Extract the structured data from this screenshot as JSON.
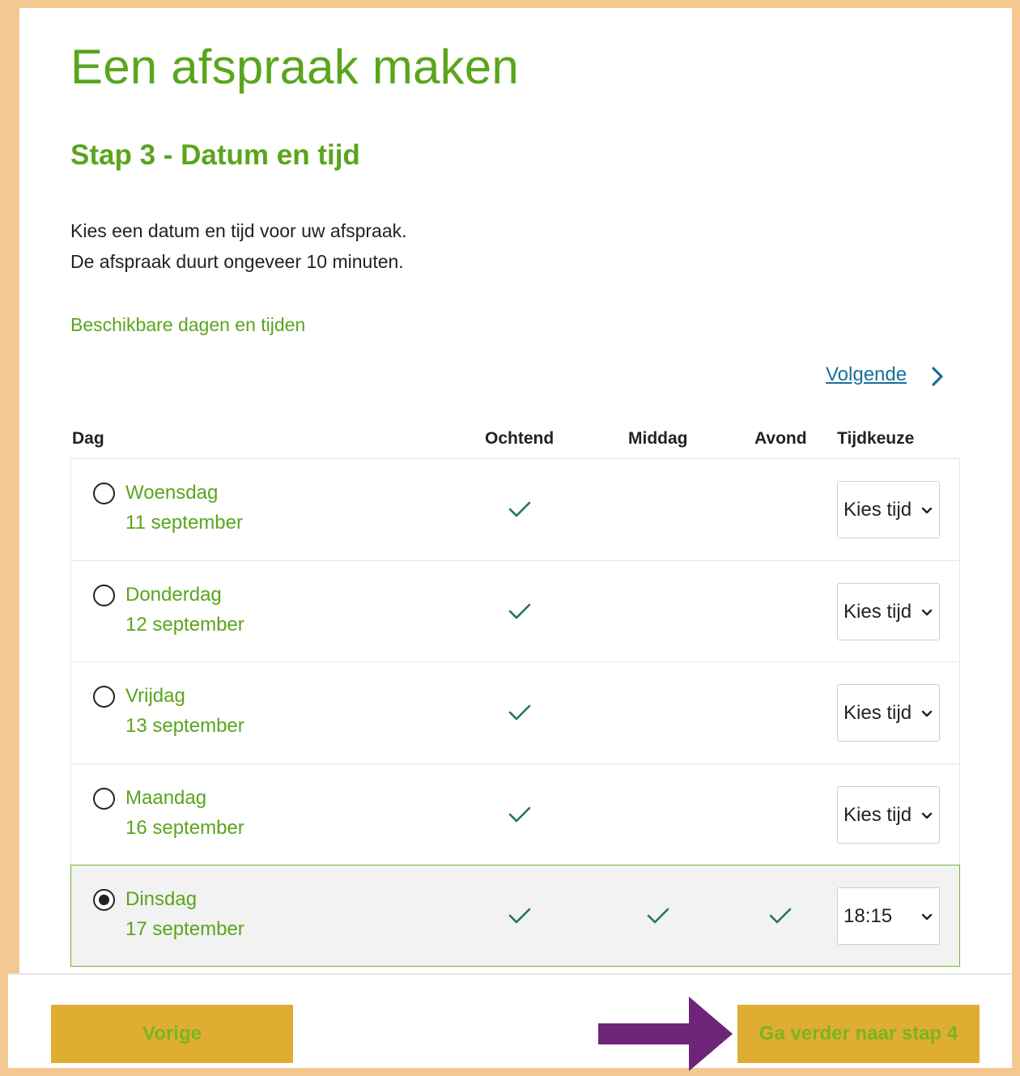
{
  "page": {
    "title": "Een afspraak maken",
    "step": "Stap 3 - Datum en tijd",
    "intro_line1": "Kies een datum en tijd voor uw afspraak.",
    "intro_line2": "De afspraak duurt ongeveer 10 minuten.",
    "subheading": "Beschikbare dagen en tijden",
    "next_link": "Volgende"
  },
  "table": {
    "headers": {
      "day": "Dag",
      "morning": "Ochtend",
      "afternoon": "Middag",
      "evening": "Avond",
      "time": "Tijdkeuze"
    },
    "rows": [
      {
        "day": "Woensdag",
        "date": "11 september",
        "selected": false,
        "morning": true,
        "afternoon": false,
        "evening": false,
        "time_value": "Kies tijd"
      },
      {
        "day": "Donderdag",
        "date": "12 september",
        "selected": false,
        "morning": true,
        "afternoon": false,
        "evening": false,
        "time_value": "Kies tijd"
      },
      {
        "day": "Vrijdag",
        "date": "13 september",
        "selected": false,
        "morning": true,
        "afternoon": false,
        "evening": false,
        "time_value": "Kies tijd"
      },
      {
        "day": "Maandag",
        "date": "16 september",
        "selected": false,
        "morning": true,
        "afternoon": false,
        "evening": false,
        "time_value": "Kies tijd"
      },
      {
        "day": "Dinsdag",
        "date": "17 september",
        "selected": true,
        "morning": true,
        "afternoon": true,
        "evening": true,
        "time_value": "18:15"
      }
    ]
  },
  "footer": {
    "prev_label": "Vorige",
    "next_label": "Ga verder naar stap 4"
  },
  "colors": {
    "green_text": "#5aa51c",
    "button_bg": "#e0ad33",
    "button_text": "#7ab51d",
    "frame": "#f5c892",
    "arrow": "#6d2479",
    "check": "#1f7a4f",
    "link": "#1a6f9c"
  },
  "icons": {
    "next": "chevron-right-icon",
    "check": "check-icon",
    "caret": "chevron-down-icon",
    "annotation": "arrow-right-icon"
  }
}
